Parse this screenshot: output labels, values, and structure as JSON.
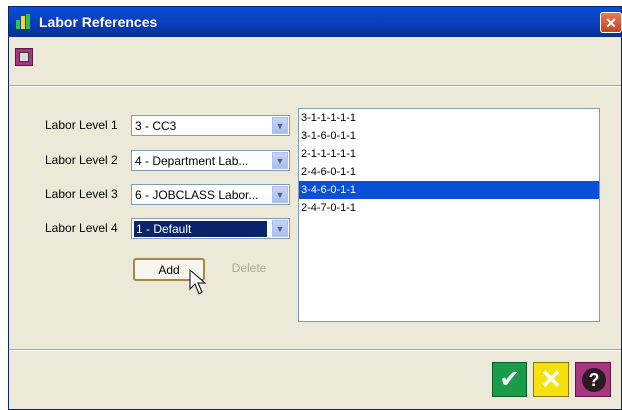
{
  "window": {
    "title": "Labor References",
    "close_glyph": "✕"
  },
  "toolbar": {
    "save_icon": "save-icon"
  },
  "fields": [
    {
      "label": "Labor Level 1",
      "value": "3 - CC3"
    },
    {
      "label": "Labor Level 2",
      "value": "4 - Department Lab..."
    },
    {
      "label": "Labor Level 3",
      "value": "6 - JOBCLASS Labor..."
    },
    {
      "label": "Labor Level 4",
      "value": "1 - Default"
    }
  ],
  "list": {
    "items": [
      "3-1-1-1-1-1",
      "3-1-6-0-1-1",
      "2-1-1-1-1-1",
      "2-4-6-0-1-1",
      "3-4-6-0-1-1",
      "2-4-7-0-1-1"
    ],
    "selected_index": 4
  },
  "buttons": {
    "add": "Add",
    "delete": "Delete"
  },
  "footer": {
    "ok_glyph": "✔",
    "cancel_glyph": "✕",
    "help_glyph": "?"
  },
  "colors": {
    "title_blue": "#0a3bb8",
    "selection": "#0a4fd8",
    "ok_green": "#1a9c4a",
    "cancel_yellow": "#f4e10e",
    "help_purple": "#a8367e"
  }
}
